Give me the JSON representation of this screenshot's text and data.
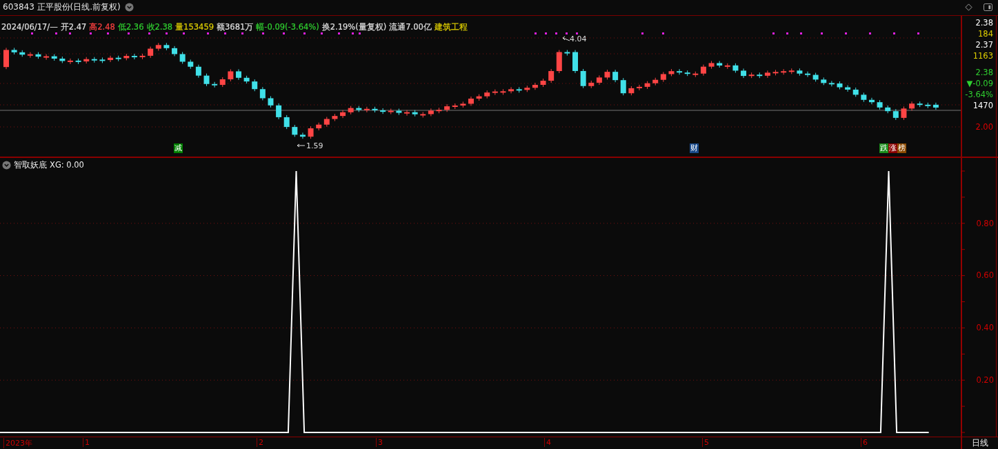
{
  "title": {
    "text": "603843 正平股份(日线.前复权)"
  },
  "quote_line": [
    {
      "text": "2024/06/17/—",
      "color": "#e0e0e0"
    },
    {
      "text": "开2.47",
      "color": "#e0e0e0"
    },
    {
      "text": "高2.48",
      "color": "#ff4040"
    },
    {
      "text": "低2.36",
      "color": "#30d030"
    },
    {
      "text": "收2.38",
      "color": "#30d030"
    },
    {
      "text": "量153459",
      "color": "#e0d000"
    },
    {
      "text": "额3681万",
      "color": "#e0e0e0"
    },
    {
      "text": "幅-0.09(-3.64%)",
      "color": "#30d030"
    },
    {
      "text": "换2.19%(量复权)",
      "color": "#e0e0e0"
    },
    {
      "text": "流通7.00亿",
      "color": "#e0e0e0"
    },
    {
      "text": "建筑工程",
      "color": "#e0d000"
    }
  ],
  "annotations": [
    {
      "text": "4.04"
    },
    {
      "text": "1.59"
    }
  ],
  "markers": [
    {
      "text": "减",
      "color": "#008000"
    },
    {
      "text": "财",
      "color": "#1a4a8a"
    },
    {
      "text": "跌",
      "color": "#1a8c1a"
    },
    {
      "text": "涨",
      "color": "#8c0000"
    },
    {
      "text": "榜",
      "color": "#8c4a00"
    }
  ],
  "price_axis": [
    {
      "text": "2.38",
      "color": "#ffffff"
    },
    {
      "text": "184",
      "color": "#e0d000"
    },
    {
      "text": "2.37",
      "color": "#ffffff"
    },
    {
      "text": "1163",
      "color": "#e0d000"
    },
    {
      "text": "2.38",
      "color": "#30d030"
    },
    {
      "text": "▼-0.09",
      "color": "#30d030"
    },
    {
      "text": "-3.64%",
      "color": "#30d030"
    },
    {
      "text": "1470",
      "color": "#ffffff"
    },
    {
      "text": "2.00",
      "color": "#e00000"
    }
  ],
  "indicator": {
    "name": "智取妖底",
    "reading": ": 0.00",
    "chart_data": {
      "type": "line",
      "ylim": [
        0,
        1
      ],
      "grid": true,
      "yticks": [
        {
          "value": 0.2,
          "label": "0.20"
        },
        {
          "value": 0.4,
          "label": "0.40"
        },
        {
          "value": 0.6,
          "label": "0.60"
        },
        {
          "value": 0.8,
          "label": "0.80"
        }
      ],
      "series": [
        {
          "name": "XG",
          "color": "#ffffff",
          "values": [
            0,
            0,
            0,
            0,
            0,
            0,
            0,
            0,
            0,
            0,
            0,
            0,
            0,
            0,
            0,
            0,
            0,
            0,
            0,
            0,
            0,
            0,
            0,
            0,
            0,
            0,
            0,
            0,
            0,
            0,
            0,
            0,
            0,
            0,
            0,
            0,
            0,
            1,
            0,
            0,
            0,
            0,
            0,
            0,
            0,
            0,
            0,
            0,
            0,
            0,
            0,
            0,
            0,
            0,
            0,
            0,
            0,
            0,
            0,
            0,
            0,
            0,
            0,
            0,
            0,
            0,
            0,
            0,
            0,
            0,
            0,
            0,
            0,
            0,
            0,
            0,
            0,
            0,
            0,
            0,
            0,
            0,
            0,
            0,
            0,
            0,
            0,
            0,
            0,
            0,
            0,
            0,
            0,
            0,
            0,
            0,
            0,
            0,
            0,
            0,
            0,
            0,
            0,
            0,
            0,
            0,
            0,
            0,
            0,
            0,
            0,
            1,
            0,
            0,
            0,
            0,
            0,
            null,
            null,
            null,
            null
          ]
        }
      ]
    }
  },
  "time_axis": [
    {
      "text": "2023年"
    },
    {
      "text": "1"
    },
    {
      "text": "2"
    },
    {
      "text": "3"
    },
    {
      "text": "4"
    },
    {
      "text": "5"
    },
    {
      "text": "6"
    }
  ],
  "period": {
    "text": "日线"
  }
}
